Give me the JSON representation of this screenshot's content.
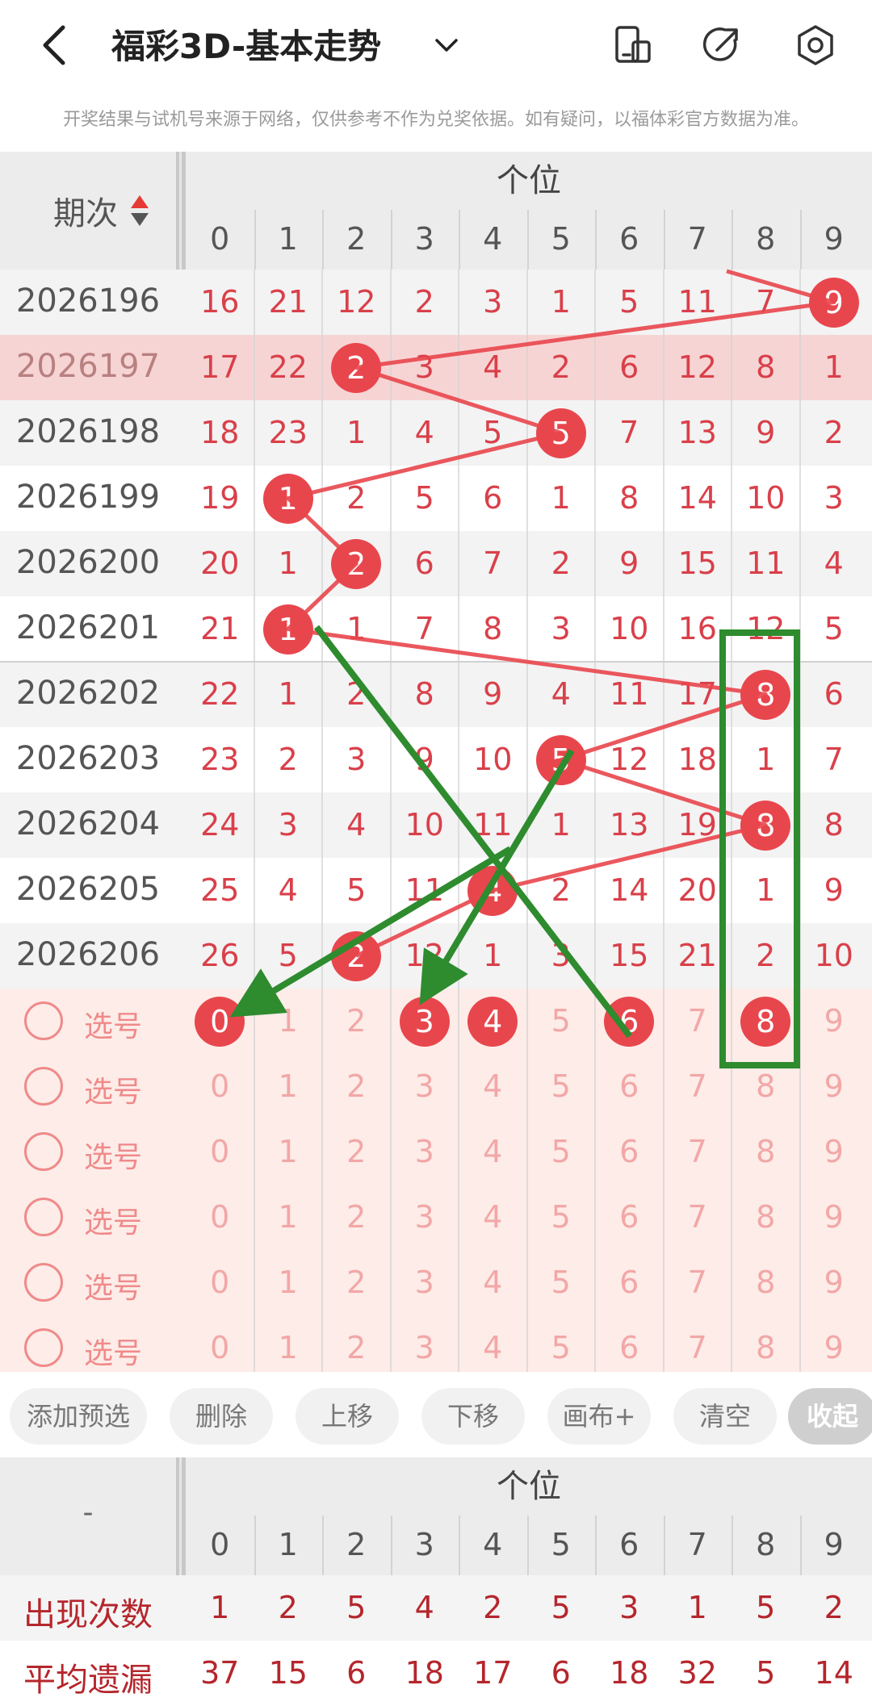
{
  "header": {
    "title": "福彩3D-基本走势",
    "icons": [
      "back-arrow-icon",
      "chevron-down-icon",
      "phone-rotate-icon",
      "share-icon",
      "settings-gear-icon"
    ]
  },
  "notice": "开奖结果与试机号来源于网络，仅供参考不作为兑奖依据。如有疑问，以福体彩官方数据为准。",
  "table": {
    "column_group": "个位",
    "issue_header": "期次",
    "digits": [
      "0",
      "1",
      "2",
      "3",
      "4",
      "5",
      "6",
      "7",
      "8",
      "9"
    ],
    "rows": [
      {
        "issue": "2026196",
        "cells": [
          "16",
          "21",
          "12",
          "2",
          "3",
          "1",
          "5",
          "11",
          "7",
          "9"
        ],
        "hit": 9
      },
      {
        "issue": "2026197",
        "cells": [
          "17",
          "22",
          "2",
          "3",
          "4",
          "2",
          "6",
          "12",
          "8",
          "1"
        ],
        "hit": 2
      },
      {
        "issue": "2026198",
        "cells": [
          "18",
          "23",
          "1",
          "4",
          "5",
          "5",
          "7",
          "13",
          "9",
          "2"
        ],
        "hit": 5
      },
      {
        "issue": "2026199",
        "cells": [
          "19",
          "1",
          "2",
          "5",
          "6",
          "1",
          "8",
          "14",
          "10",
          "3"
        ],
        "hit": 1
      },
      {
        "issue": "2026200",
        "cells": [
          "20",
          "1",
          "2",
          "6",
          "7",
          "2",
          "9",
          "15",
          "11",
          "4"
        ],
        "hit": 2
      },
      {
        "issue": "2026201",
        "cells": [
          "21",
          "1",
          "1",
          "7",
          "8",
          "3",
          "10",
          "16",
          "12",
          "5"
        ],
        "hit": 1
      },
      {
        "issue": "2026202",
        "cells": [
          "22",
          "1",
          "2",
          "8",
          "9",
          "4",
          "11",
          "17",
          "8",
          "6"
        ],
        "hit": 8
      },
      {
        "issue": "2026203",
        "cells": [
          "23",
          "2",
          "3",
          "9",
          "10",
          "5",
          "12",
          "18",
          "1",
          "7"
        ],
        "hit": 5
      },
      {
        "issue": "2026204",
        "cells": [
          "24",
          "3",
          "4",
          "10",
          "11",
          "1",
          "13",
          "19",
          "8",
          "8"
        ],
        "hit": 8
      },
      {
        "issue": "2026205",
        "cells": [
          "25",
          "4",
          "5",
          "11",
          "4",
          "2",
          "14",
          "20",
          "1",
          "9"
        ],
        "hit": 4
      },
      {
        "issue": "2026206",
        "cells": [
          "26",
          "5",
          "2",
          "12",
          "1",
          "3",
          "15",
          "21",
          "2",
          "10"
        ],
        "hit": 2
      }
    ],
    "pick_rows": [
      {
        "label": "选号",
        "selected": [
          0,
          3,
          4,
          6,
          8
        ]
      },
      {
        "label": "选号",
        "selected": []
      },
      {
        "label": "选号",
        "selected": []
      },
      {
        "label": "选号",
        "selected": []
      },
      {
        "label": "选号",
        "selected": []
      },
      {
        "label": "选号",
        "selected": []
      }
    ]
  },
  "toolbar": {
    "add": "添加预选",
    "delete": "删除",
    "up": "上移",
    "down": "下移",
    "canvas": "画布+",
    "clear": "清空",
    "collapse": "收起"
  },
  "stats": {
    "column_group": "个位",
    "left_header": "-",
    "digits": [
      "0",
      "1",
      "2",
      "3",
      "4",
      "5",
      "6",
      "7",
      "8",
      "9"
    ],
    "occurrence_label": "出现次数",
    "occurrence": [
      "1",
      "2",
      "5",
      "4",
      "2",
      "5",
      "3",
      "1",
      "5",
      "2"
    ],
    "avg_miss_label": "平均遗漏",
    "avg_miss": [
      "37",
      "15",
      "6",
      "18",
      "17",
      "6",
      "18",
      "32",
      "5",
      "14"
    ]
  },
  "colors": {
    "hit_ball": "#e8464d",
    "miss_text": "#d9404a",
    "highlight_row": "#f7d4d4",
    "pick_bg": "#fdece8",
    "annotation_green": "#2e8b2e"
  }
}
